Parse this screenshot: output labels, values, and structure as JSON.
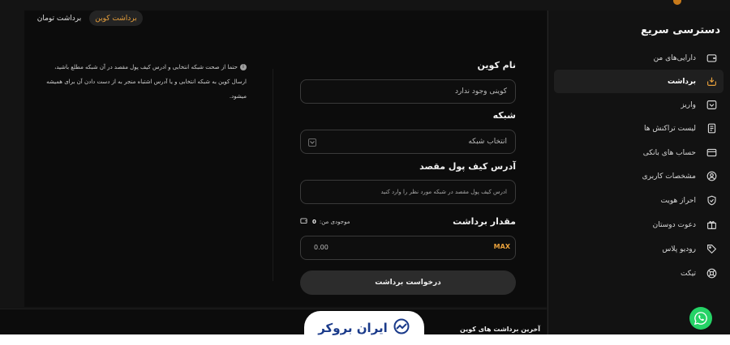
{
  "sidebar": {
    "title": "دسترسی سریع",
    "items": [
      {
        "label": "دارایی‌های من",
        "icon": "wallet-icon"
      },
      {
        "label": "برداشت",
        "icon": "withdraw-icon",
        "active": true
      },
      {
        "label": "واریز",
        "icon": "deposit-icon"
      },
      {
        "label": "لیست تراکنش ها",
        "icon": "receipt-icon"
      },
      {
        "label": "حساب های بانکی",
        "icon": "card-icon"
      },
      {
        "label": "مشخصات کاربری",
        "icon": "user-icon"
      },
      {
        "label": "احراز هویت",
        "icon": "shield-check-icon"
      },
      {
        "label": "دعوت دوستان",
        "icon": "gift-icon"
      },
      {
        "label": "رودیو پلاس",
        "icon": "tag-icon"
      },
      {
        "label": "تیکت",
        "icon": "support-icon"
      }
    ]
  },
  "tabs": {
    "coin": "برداشت کوین",
    "toman": "برداشت تومان"
  },
  "note": {
    "text": "حتما از صحت شبکه انتخابی و ادرس کیف پول مقصد در آن شبکه مطلع باشید، ارسال کوین به شبکه انتخابی و یا آدرس اشتباه منجر به از دست دادن آن برای همیشه میشود."
  },
  "form": {
    "coin_label": "نام کوین",
    "coin_value": "کوینی وجود ندارد",
    "network_label": "شبکه",
    "network_value": "انتخاب شبکه",
    "address_label": "آدرس کیف پول مقصد",
    "address_placeholder": "ادرس کیف پول مقصد در شبکه مورد نظر را وارد کنید",
    "amount_label": "مقدار برداشت",
    "balance_label": "موجودی من:",
    "balance_value": "0",
    "amount_value": "0.00",
    "max_label": "MAX",
    "submit_label": "درخواست برداشت"
  },
  "bottom": {
    "title": "آخرین برداشت های کوین"
  },
  "logo": {
    "text": "ایران بروکر"
  },
  "colors": {
    "accent": "#e8a03c",
    "whatsapp": "#25d366",
    "logo": "#1a3a8a"
  }
}
